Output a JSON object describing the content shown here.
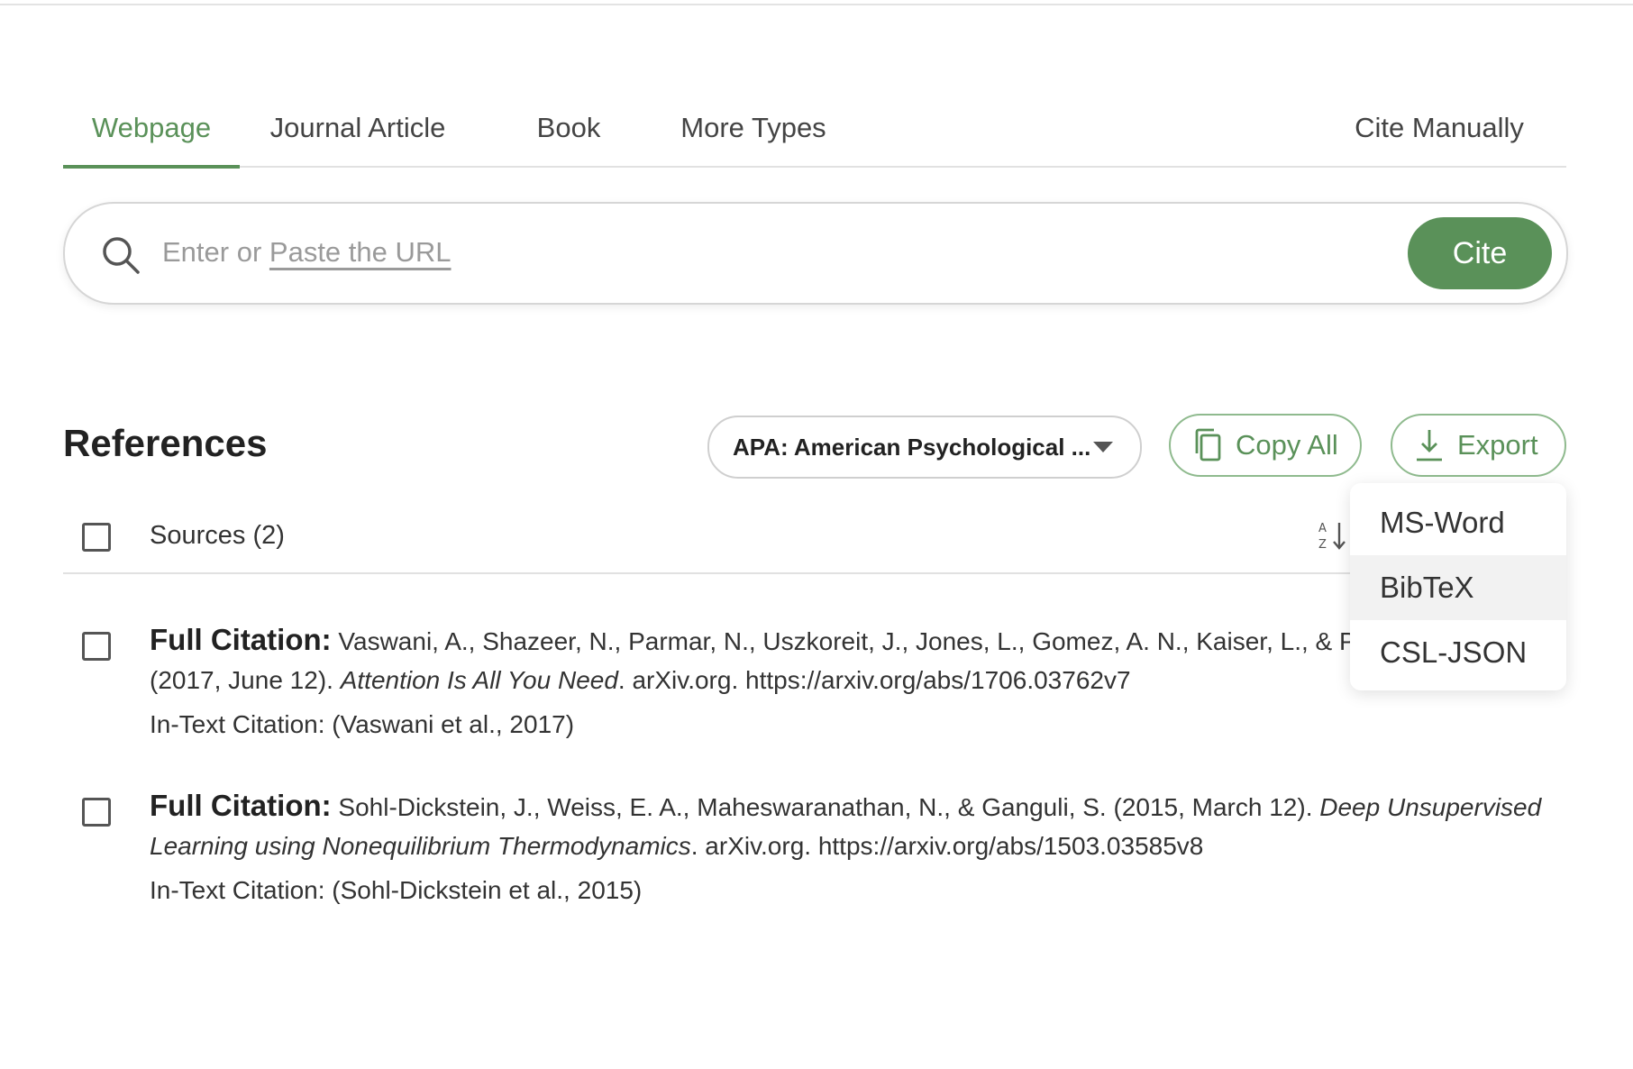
{
  "tabs": [
    {
      "label": "Webpage",
      "active": true
    },
    {
      "label": "Journal Article",
      "active": false
    },
    {
      "label": "Book",
      "active": false
    },
    {
      "label": "More Types",
      "active": false
    }
  ],
  "cite_manually_label": "Cite Manually",
  "search": {
    "placeholder": "Enter or Paste the URL",
    "placeholder_prefix": "Enter or",
    "placeholder_link": "Paste the URL",
    "value": "",
    "icon": "search-icon",
    "cite_label": "Cite"
  },
  "references": {
    "title": "References",
    "style_select": "APA: American Psychological ...",
    "copy_all_label": "Copy All",
    "export_label": "Export",
    "sources_label": "Sources (2)"
  },
  "export_menu": {
    "items": [
      "MS-Word",
      "BibTeX",
      "CSL-JSON"
    ],
    "hovered": "BibTeX"
  },
  "citations": [
    {
      "lead": "Full Citation:",
      "before": " Vaswani, A., Shazeer, N., Parmar, N., Uszkoreit, J., Jones, L., Gomez, A. N., Kaiser, L., & Polosukhin, I. (2017, June 12). ",
      "title": "Attention Is All You Need",
      "after": ". arXiv.org. https://arxiv.org/abs/1706.03762v7",
      "in_text": "In-Text Citation: (Vaswani et al., 2017)"
    },
    {
      "lead": "Full Citation:",
      "before": " Sohl-Dickstein, J., Weiss, E. A., Maheswaranathan, N., & Ganguli, S. (2015, March 12). ",
      "title": "Deep Unsupervised Learning using Nonequilibrium Thermodynamics",
      "after": ". arXiv.org. https://arxiv.org/abs/1503.03585v8",
      "in_text": "In-Text Citation: (Sohl-Dickstein et al., 2015)"
    }
  ],
  "colors": {
    "accent": "#5a9159",
    "accent_border": "#8fba8e",
    "hover_bg": "#f2f2f2"
  }
}
